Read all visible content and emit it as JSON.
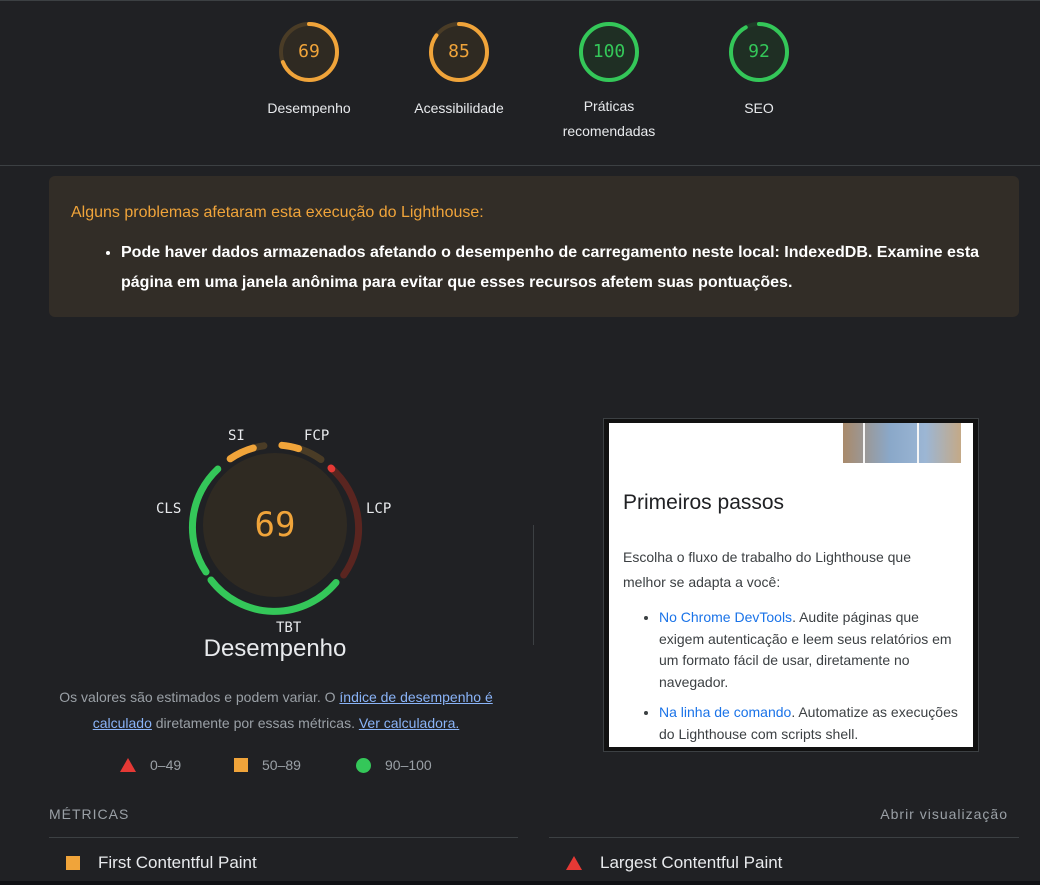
{
  "header": {
    "gauges": [
      {
        "score": "69",
        "label": "Desempenho",
        "color": "#f0a43a",
        "percent": 69
      },
      {
        "score": "85",
        "label": "Acessibilidade",
        "color": "#f0a43a",
        "percent": 85
      },
      {
        "score": "100",
        "label": "Práticas recomendadas",
        "color": "#34c759",
        "percent": 100
      },
      {
        "score": "92",
        "label": "SEO",
        "color": "#34c759",
        "percent": 92
      }
    ]
  },
  "warning": {
    "title": "Alguns problemas afetaram esta execução do Lighthouse:",
    "items": [
      "Pode haver dados armazenados afetando o desempenho de carregamento neste local: IndexedDB. Examine esta página em uma janela anônima para evitar que esses recursos afetem suas pontuações."
    ]
  },
  "performance": {
    "score": "69",
    "title": "Desempenho",
    "metric_tags": {
      "si": "SI",
      "fcp": "FCP",
      "lcp": "LCP",
      "tbt": "TBT",
      "cls": "CLS"
    },
    "description": {
      "text1": "Os valores são estimados e podem variar. O ",
      "link1": "índice de desempenho é calculado",
      "text2": " diretamente por essas métricas. ",
      "link2": "Ver calculadora."
    },
    "legend": [
      {
        "shape": "triangle",
        "label": "0–49",
        "color": "#e53935"
      },
      {
        "shape": "square",
        "label": "50–89",
        "color": "#f0a43a"
      },
      {
        "shape": "circle",
        "label": "90–100",
        "color": "#34c759"
      }
    ]
  },
  "screenshot": {
    "heading": "Primeiros passos",
    "intro": "Escolha o fluxo de trabalho do Lighthouse que melhor se adapta a você:",
    "items": [
      {
        "link": "No Chrome DevTools",
        "text": ". Audite páginas que exigem autenticação e leem seus relatórios em um formato fácil de usar, diretamente no navegador."
      },
      {
        "link": "Na linha de comando",
        "text": ". Automatize as execuções do Lighthouse com scripts shell."
      }
    ]
  },
  "metrics": {
    "title": "MÉTRICAS",
    "open_view": "Abrir visualização",
    "items": [
      {
        "name": "First Contentful Paint",
        "rating": "average"
      },
      {
        "name": "Largest Contentful Paint",
        "rating": "fail"
      }
    ]
  }
}
